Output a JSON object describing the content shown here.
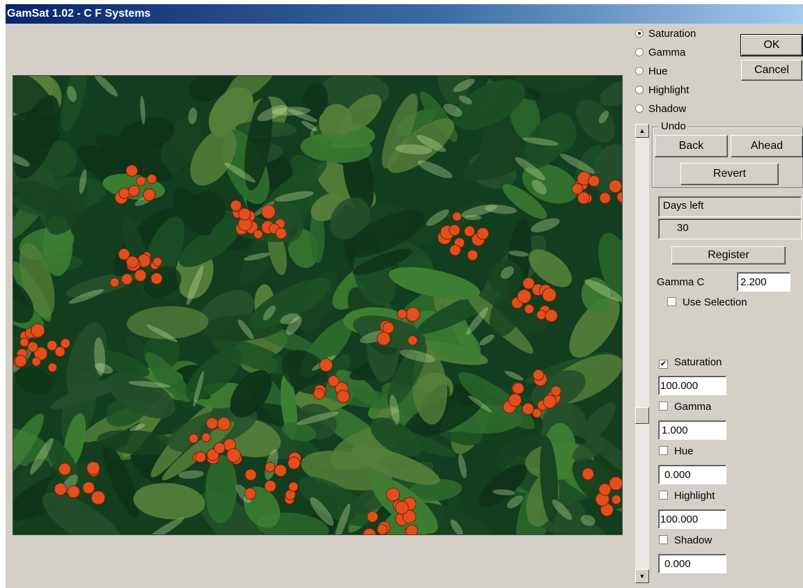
{
  "window": {
    "title": "GamSat 1.02 - C F Systems"
  },
  "mode": {
    "selected": "Saturation",
    "options": [
      "Saturation",
      "Gamma",
      "Hue",
      "Highlight",
      "Shadow"
    ]
  },
  "buttons": {
    "ok": "OK",
    "cancel": "Cancel",
    "register": "Register"
  },
  "undo": {
    "label": "Undo",
    "back": "Back",
    "ahead": "Ahead",
    "revert": "Revert"
  },
  "trial": {
    "label": "Days left",
    "value": "30"
  },
  "gamma_c": {
    "label": "Gamma C",
    "value": "2.200"
  },
  "use_selection": {
    "label": "Use Selection",
    "checked": false
  },
  "slider": {
    "fraction": 0.65
  },
  "adjustments": [
    {
      "label": "Saturation",
      "checked": true,
      "value": "100.000"
    },
    {
      "label": "Gamma",
      "checked": false,
      "value": "1.000"
    },
    {
      "label": "Hue",
      "checked": false,
      "value": " 0.000"
    },
    {
      "label": "Highlight",
      "checked": false,
      "value": "100.000"
    },
    {
      "label": "Shadow",
      "checked": false,
      "value": " 0.000"
    }
  ],
  "icons": {
    "scroll_up": "triangle-up-icon",
    "scroll_down": "triangle-down-icon",
    "checkmark": "check-icon"
  },
  "colors": {
    "title_start": "#0a246a",
    "title_end": "#a6caf0",
    "face": "#d4d0c8",
    "leaf_dark": "#123d1f",
    "leaf": "#2d6a2d",
    "berry": "#e0501d"
  }
}
